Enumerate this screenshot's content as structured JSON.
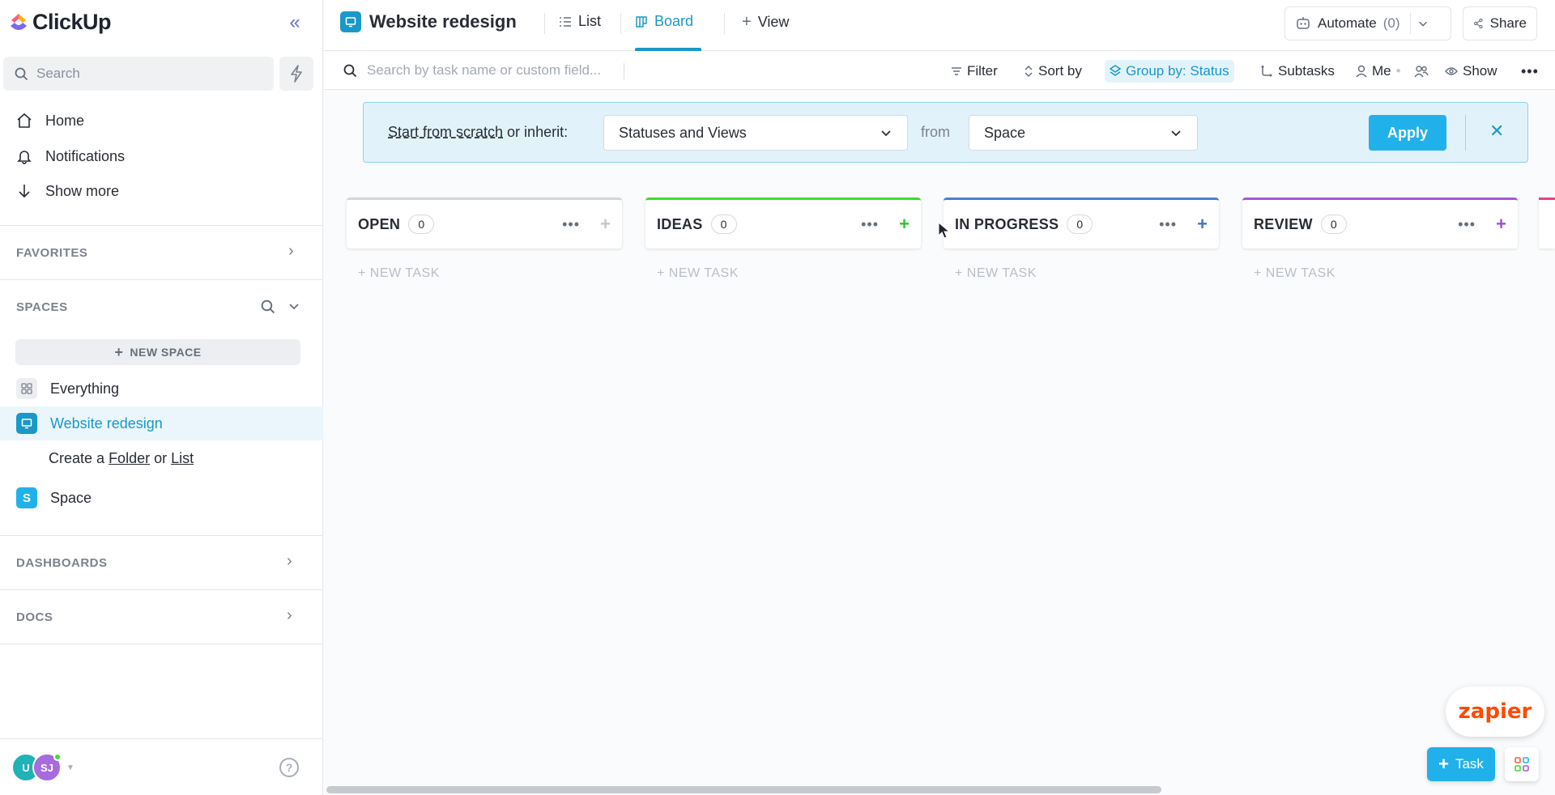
{
  "app": {
    "name": "ClickUp"
  },
  "sidebar": {
    "search_placeholder": "Search",
    "nav": [
      {
        "label": "Home",
        "icon": "home-icon"
      },
      {
        "label": "Notifications",
        "icon": "bell-icon"
      },
      {
        "label": "Show more",
        "icon": "arrow-down-icon"
      }
    ],
    "favorites_label": "FAVORITES",
    "spaces_label": "SPACES",
    "new_space_label": "NEW SPACE",
    "spaces": [
      {
        "label": "Everything",
        "icon": "grid-icon"
      },
      {
        "label": "Website redesign",
        "icon": "monitor-icon",
        "active": true
      },
      {
        "label": "Space",
        "icon_letter": "S"
      }
    ],
    "create": {
      "prefix": "Create a",
      "folder": "Folder",
      "or": "or",
      "list": "List"
    },
    "dashboards_label": "DASHBOARDS",
    "docs_label": "DOCS",
    "avatars": [
      {
        "initials": "U",
        "color": "#1fb2b8"
      },
      {
        "initials": "SJ",
        "color": "#a66bdc"
      }
    ],
    "help": "?"
  },
  "header": {
    "title": "Website redesign",
    "tabs": [
      {
        "label": "List",
        "icon": "list-icon"
      },
      {
        "label": "Board",
        "icon": "board-icon",
        "active": true
      }
    ],
    "add_view_label": "View",
    "automate_label": "Automate",
    "automate_count": "(0)",
    "share_label": "Share"
  },
  "toolbar": {
    "search_placeholder": "Search by task name or custom field...",
    "filter_label": "Filter",
    "sort_label": "Sort by",
    "group_label": "Group by: Status",
    "subtasks_label": "Subtasks",
    "me_label": "Me",
    "show_label": "Show"
  },
  "banner": {
    "scratch_link": "Start from scratch",
    "inherit_text": "or inherit:",
    "inherit_value": "Statuses and Views",
    "from_label": "from",
    "from_value": "Space",
    "apply_label": "Apply"
  },
  "board": {
    "columns": [
      {
        "title": "OPEN",
        "count": "0",
        "color": "#d3d5d9",
        "plus_color": "#c4c7cd",
        "new_task": "+ NEW TASK"
      },
      {
        "title": "IDEAS",
        "count": "0",
        "color": "#3ddc34",
        "plus_color": "#2fc626",
        "new_task": "+ NEW TASK"
      },
      {
        "title": "IN PROGRESS",
        "count": "0",
        "color": "#4a7fd4",
        "plus_color": "#3f74cc",
        "new_task": "+ NEW TASK"
      },
      {
        "title": "REVIEW",
        "count": "0",
        "color": "#a656da",
        "plus_color": "#9f4ed8",
        "new_task": "+ NEW TASK"
      }
    ]
  },
  "widgets": {
    "zapier_label": "zapier",
    "task_button_label": "Task"
  },
  "colors": {
    "accent": "#21b1ea",
    "active_text": "#1a98c9"
  }
}
